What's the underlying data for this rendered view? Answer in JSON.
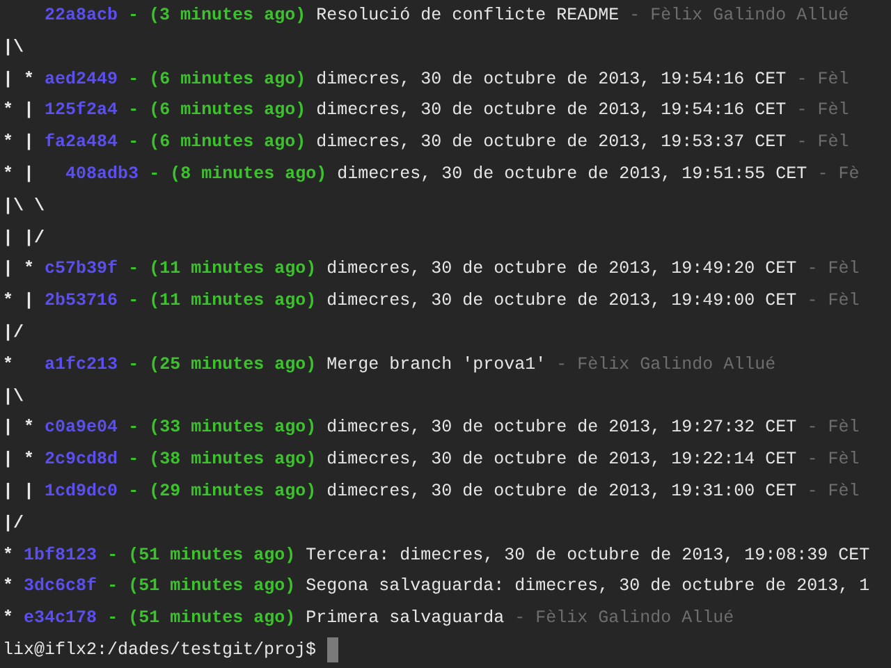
{
  "terminal": {
    "lines": [
      {
        "kind": "commit",
        "hash": "22a8acb",
        "time": "- (3 minutes ago)",
        "message": "Resolució de conflicte README",
        "author": "- Fèlix Galindo Allué"
      },
      {
        "kind": "graph",
        "graph": "|\\"
      },
      {
        "kind": "commit",
        "graph": "| *",
        "hash": "aed2449",
        "time": "- (6 minutes ago)",
        "message": "dimecres, 30 de octubre de 2013, 19:54:16 CET",
        "author": "- Fèl"
      },
      {
        "kind": "commit",
        "graph": "* |",
        "hash": "125f2a4",
        "time": "- (6 minutes ago)",
        "message": "dimecres, 30 de octubre de 2013, 19:54:16 CET",
        "author": "- Fèl"
      },
      {
        "kind": "commit",
        "graph": "* |",
        "hash": "fa2a484",
        "time": "- (6 minutes ago)",
        "message": "dimecres, 30 de octubre de 2013, 19:53:37 CET",
        "author": "- Fèl"
      },
      {
        "kind": "commit",
        "graph": "* |  ",
        "hash": "408adb3",
        "time": "- (8 minutes ago)",
        "message": "dimecres, 30 de octubre de 2013, 19:51:55 CET",
        "author": "- Fè"
      },
      {
        "kind": "graph",
        "graph": "|\\ \\"
      },
      {
        "kind": "graph",
        "graph": "| |/"
      },
      {
        "kind": "commit",
        "graph": "| *",
        "hash": "c57b39f",
        "time": "- (11 minutes ago)",
        "message": "dimecres, 30 de octubre de 2013, 19:49:20 CET",
        "author": "- Fèl"
      },
      {
        "kind": "commit",
        "graph": "* |",
        "hash": "2b53716",
        "time": "- (11 minutes ago)",
        "message": "dimecres, 30 de octubre de 2013, 19:49:00 CET",
        "author": "- Fèl"
      },
      {
        "kind": "graph",
        "graph": "|/"
      },
      {
        "kind": "commit",
        "graph": "*  ",
        "hash": "a1fc213",
        "time": "- (25 minutes ago)",
        "message": "Merge branch 'prova1'",
        "author": "- Fèlix Galindo Allué"
      },
      {
        "kind": "graph",
        "graph": "|\\"
      },
      {
        "kind": "commit",
        "graph": "| *",
        "hash": "c0a9e04",
        "time": "- (33 minutes ago)",
        "message": "dimecres, 30 de octubre de 2013, 19:27:32 CET",
        "author": "- Fèl"
      },
      {
        "kind": "commit",
        "graph": "| *",
        "hash": "2c9cd8d",
        "time": "- (38 minutes ago)",
        "message": "dimecres, 30 de octubre de 2013, 19:22:14 CET",
        "author": "- Fèl"
      },
      {
        "kind": "commit",
        "graph": "| |",
        "hash": "1cd9dc0",
        "time": "- (29 minutes ago)",
        "message": "dimecres, 30 de octubre de 2013, 19:31:00 CET",
        "author": "- Fèl"
      },
      {
        "kind": "graph",
        "graph": "|/"
      },
      {
        "kind": "commit",
        "graph": "*",
        "hash": "1bf8123",
        "time": "- (51 minutes ago)",
        "message": "Tercera: dimecres, 30 de octubre de 2013, 19:08:39 CET"
      },
      {
        "kind": "commit",
        "graph": "*",
        "hash": "3dc6c8f",
        "time": "- (51 minutes ago)",
        "message": "Segona salvaguarda: dimecres, 30 de octubre de 2013, 1"
      },
      {
        "kind": "commit",
        "graph": "*",
        "hash": "e34c178",
        "time": "- (51 minutes ago)",
        "message": "Primera salvaguarda",
        "author": "- Fèlix Galindo Allué"
      },
      {
        "kind": "prompt",
        "prompt": "lix@iflx2:/dades/testgit/proj$"
      }
    ]
  }
}
